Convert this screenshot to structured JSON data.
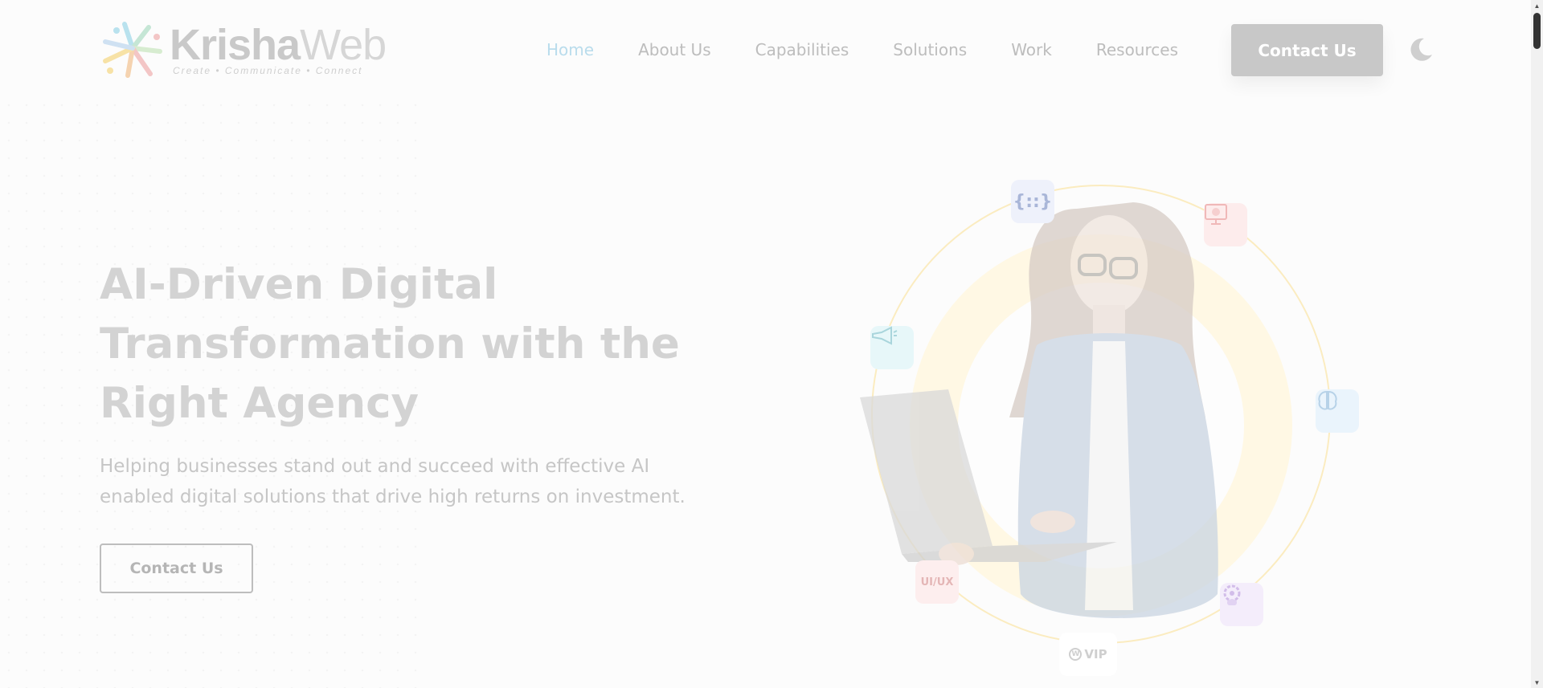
{
  "brand": {
    "name_bold": "Krisha",
    "name_light": "Web",
    "tagline": "Create • Communicate • Connect"
  },
  "nav": {
    "items": [
      {
        "label": "Home",
        "active": true
      },
      {
        "label": "About Us",
        "active": false
      },
      {
        "label": "Capabilities",
        "active": false
      },
      {
        "label": "Solutions",
        "active": false
      },
      {
        "label": "Work",
        "active": false
      },
      {
        "label": "Resources",
        "active": false
      }
    ],
    "cta_label": "Contact Us",
    "theme_toggle_icon": "moon-icon"
  },
  "hero": {
    "title": "AI-Driven Digital Transformation with the Right Agency",
    "subtitle": "Helping businesses stand out and succeed with effective AI enabled digital solutions that drive high returns on investment.",
    "button_label": "Contact Us"
  },
  "illustration": {
    "badges": [
      {
        "name": "code-braces-icon",
        "color": "#eef1fb"
      },
      {
        "name": "monitor-icon",
        "color": "#fdecec"
      },
      {
        "name": "megaphone-icon",
        "color": "#e7f7f9"
      },
      {
        "name": "brain-icon",
        "color": "#eaf4fc"
      },
      {
        "name": "ui-ux-badge",
        "text": "UI/UX",
        "color": "#fdeeee"
      },
      {
        "name": "gear-user-icon",
        "color": "#f4edfb"
      },
      {
        "name": "wordpress-vip-badge",
        "text": "VIP",
        "color": "#ffffff"
      }
    ],
    "ring_color": "#fbe7a6",
    "disc_color": "#fff7dd"
  },
  "colors": {
    "nav_active": "#b9dcec",
    "cta_bg": "#c8c8c8",
    "title": "#d3d3d3"
  }
}
